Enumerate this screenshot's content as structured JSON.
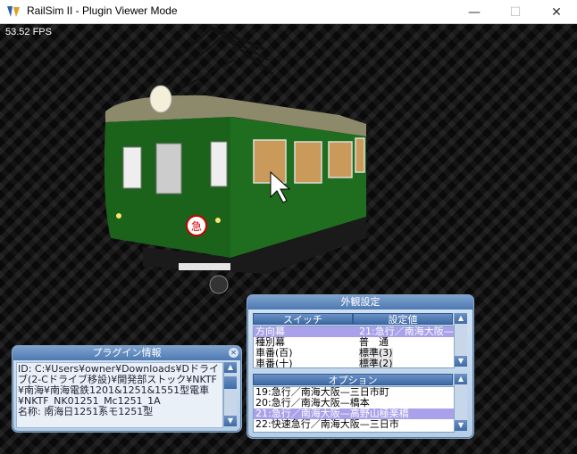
{
  "window": {
    "title": "RailSim II - Plugin Viewer Mode",
    "min": "—",
    "max": "☐",
    "close": "✕"
  },
  "viewport": {
    "fps": "53.52 FPS",
    "car_emblem": "急"
  },
  "appearance_panel": {
    "title": "外観設定",
    "switch_header": "スイッチ",
    "value_header": "設定値",
    "switch_rows": [
      {
        "name": "方向幕",
        "value": "21:急行／南海大阪—",
        "selected": true
      },
      {
        "name": "種別幕",
        "value": "普　通",
        "selected": false
      },
      {
        "name": "車番(百)",
        "value": "標準(3)",
        "selected": false
      },
      {
        "name": "車番(十)",
        "value": "標準(2)",
        "selected": false
      }
    ],
    "option_header": "オプション",
    "option_rows": [
      {
        "label": "19:急行／南海大阪—三日市町",
        "selected": false
      },
      {
        "label": "20:急行／南海大阪—橋本",
        "selected": false
      },
      {
        "label": "21:急行／南海大阪—高野山極楽橋",
        "selected": true
      },
      {
        "label": "22:快速急行／南海大阪—三日市",
        "selected": false
      }
    ]
  },
  "plugin_info_panel": {
    "title": "プラグイン情報",
    "text": "ID: C:¥Users¥owner¥Downloads¥Dドライブ(2-Cドライブ移設)¥開発部ストック¥NKTF¥南海¥南海電鉄1201&1251&1551型電車¥NKTF_NK01251_Mc1251_1A",
    "name_line": "名称: 南海日1251系モ1251型"
  },
  "colors": {
    "car_body": "#1f6b1f",
    "roof": "#8a8a6a",
    "panel_title": "#4d78b1",
    "selection": "#a9a1e9"
  }
}
